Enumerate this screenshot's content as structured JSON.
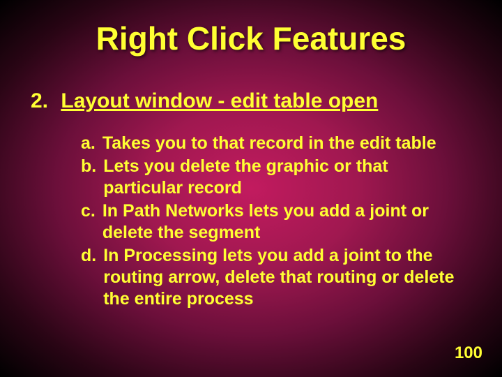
{
  "title": "Right Click Features",
  "heading": {
    "number": "2.",
    "text": "Layout window - edit table open"
  },
  "items": [
    {
      "letter": "a.",
      "text": "Takes you to that record in the edit table"
    },
    {
      "letter": "b.",
      "text": "Lets you delete the graphic or that particular record"
    },
    {
      "letter": "c.",
      "text": "In Path Networks lets you add a joint or delete the segment"
    },
    {
      "letter": "d.",
      "text": "In Processing lets you add a joint to the routing arrow, delete that routing or delete the entire process"
    }
  ],
  "page_number": "100"
}
